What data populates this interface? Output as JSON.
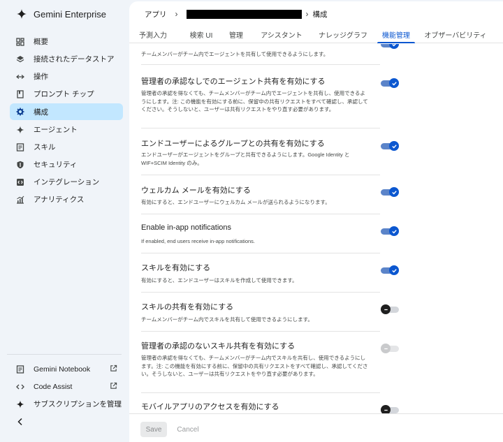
{
  "app": {
    "title": "Gemini Enterprise"
  },
  "sidebar": {
    "items": [
      {
        "label": "概要",
        "icon": "dashboard-icon"
      },
      {
        "label": "接続されたデータストア",
        "icon": "datastore-icon"
      },
      {
        "label": "操作",
        "icon": "arrows-icon"
      },
      {
        "label": "プロンプト チップ",
        "icon": "bookmark-icon"
      },
      {
        "label": "構成",
        "icon": "gear-icon",
        "active": true
      },
      {
        "label": "エージェント",
        "icon": "sparkle-icon"
      },
      {
        "label": "スキル",
        "icon": "document-icon"
      },
      {
        "label": "セキュリティ",
        "icon": "shield-icon"
      },
      {
        "label": "インテグレーション",
        "icon": "integration-icon"
      },
      {
        "label": "アナリティクス",
        "icon": "analytics-icon"
      }
    ],
    "bottom": [
      {
        "label": "Gemini Notebook",
        "icon": "notebook-icon",
        "external": true
      },
      {
        "label": "Code Assist",
        "icon": "code-icon",
        "external": true
      },
      {
        "label": "サブスクリプションを管理",
        "icon": "sparkle-icon"
      }
    ]
  },
  "breadcrumb": {
    "root": "アプリ",
    "current": "構成"
  },
  "tabs": [
    "予測入力",
    "検索 UI",
    "管理",
    "アシスタント",
    "ナレッジグラフ",
    "機能管理",
    "オブザーバビリティ"
  ],
  "active_tab": "機能管理",
  "settings": [
    {
      "title": "",
      "desc": "チームメンバーがチーム内でエージェントを共有して使用できるようにします。",
      "state": "on"
    },
    {
      "title": "管理者の承認なしでのエージェント共有を有効にする",
      "desc": "管理者の承認を得なくても、チームメンバーがチーム内でエージェントを共有し、使用できるようにします。注: この機能を有効にする前に、保留中の共有リクエストをすべて確認し、承認してください。そうしないと、ユーザーは共有リクエストをやり直す必要があります。",
      "state": "on"
    },
    {
      "title": "エンドユーザーによるグループとの共有を有効にする",
      "desc": "エンドユーザーがエージェントをグループと共有できるようにします。Google Identity と WIF+SCIM Identity のみ。",
      "state": "on"
    },
    {
      "title": "ウェルカム メールを有効にする",
      "desc": "有効にすると、エンドユーザーにウェルカム メールが送られるようになります。",
      "state": "on"
    },
    {
      "title": "Enable in-app notifications",
      "desc": "If enabled, end users receive in-app notifications.",
      "state": "on"
    },
    {
      "title": "スキルを有効にする",
      "desc": "有効にすると、エンドユーザーはスキルを作成して使用できます。",
      "state": "on"
    },
    {
      "title": "スキルの共有を有効にする",
      "desc": "チームメンバーがチーム内でスキルを共有して使用できるようにします。",
      "state": "off"
    },
    {
      "title": "管理者の承認のないスキル共有を有効にする",
      "desc": "管理者の承認を得なくても、チームメンバーがチーム内でスキルを共有し、使用できるようにします。注: この機能を有効にする前に、保留中の共有リクエストをすべて確認し、承認してください。そうしないと、ユーザーは共有リクエストをやり直す必要があります。",
      "state": "disabled"
    },
    {
      "title": "モバイルアプリのアクセスを有効にする",
      "desc": "",
      "state": "off"
    }
  ],
  "footer": {
    "save": "Save",
    "cancel": "Cancel"
  },
  "colors": {
    "accent": "#0b57d0",
    "active_nav": "#c2e7ff",
    "sidebar_bg": "#f0f4f9"
  }
}
